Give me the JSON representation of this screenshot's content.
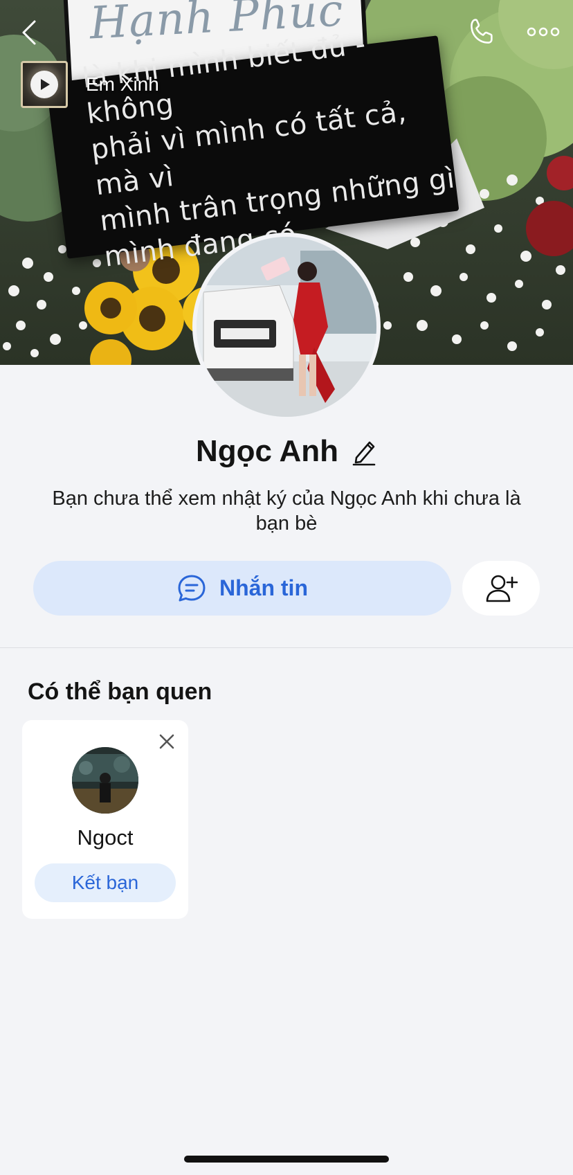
{
  "cover": {
    "sign_text": "là khi mình biết đủ - không\nphải vì mình có tất cả, mà vì\nmình trân trọng những gì\nmình đang có.",
    "board_text": "Hạnh Phúc"
  },
  "nav": {
    "back_icon": "chevron-left-icon",
    "call_icon": "phone-icon",
    "more_icon": "more-dots-icon"
  },
  "music": {
    "title": "Em Xinh",
    "icon": "play-icon"
  },
  "profile": {
    "name": "Ngọc Anh",
    "notice": "Bạn chưa thể xem nhật ký của Ngọc Anh khi chưa là bạn bè"
  },
  "actions": {
    "message_label": "Nhắn tin",
    "message_icon": "chat-bubble-icon",
    "add_friend_icon": "add-user-icon"
  },
  "suggestions": {
    "title": "Có thể bạn quen",
    "items": [
      {
        "name": "Ngoct",
        "button_label": "Kết bạn"
      }
    ]
  },
  "colors": {
    "accent": "#2a66d8",
    "accent_light": "#dce8fb",
    "background": "#f3f4f7"
  }
}
